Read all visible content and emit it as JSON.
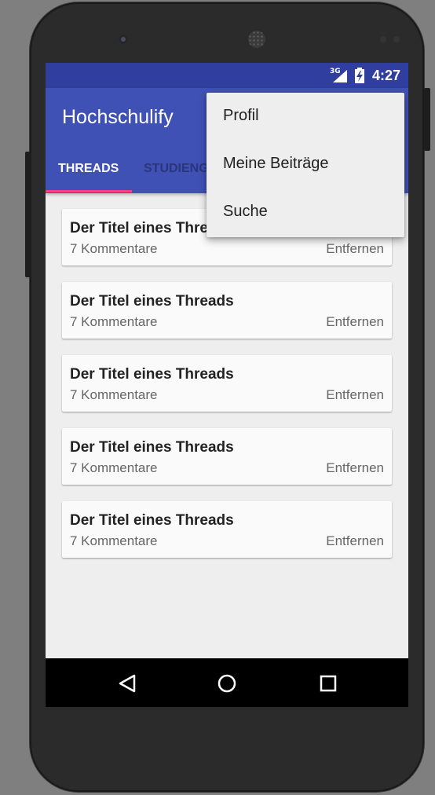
{
  "status": {
    "network": "3G",
    "time": "4:27"
  },
  "app": {
    "title": "Hochschulify"
  },
  "tabs": [
    {
      "label": "THREADS",
      "selected": true
    },
    {
      "label": "STUDIENG",
      "selected": false
    }
  ],
  "threads": [
    {
      "title": "Der Titel eines Threads",
      "comments": "7 Kommentare",
      "action": "Entfernen"
    },
    {
      "title": "Der Titel eines Threads",
      "comments": "7 Kommentare",
      "action": "Entfernen"
    },
    {
      "title": "Der Titel eines Threads",
      "comments": "7 Kommentare",
      "action": "Entfernen"
    },
    {
      "title": "Der Titel eines Threads",
      "comments": "7 Kommentare",
      "action": "Entfernen"
    },
    {
      "title": "Der Titel eines Threads",
      "comments": "7 Kommentare",
      "action": "Entfernen"
    }
  ],
  "overflow_menu": {
    "items": [
      {
        "label": "Profil"
      },
      {
        "label": "Meine Beiträge"
      },
      {
        "label": "Suche"
      }
    ]
  },
  "navbar": {
    "icons": [
      "back-icon",
      "home-icon",
      "recents-icon"
    ]
  },
  "colors": {
    "statusbar": "#303f9f",
    "appbar": "#3f51b5",
    "tab_indicator": "#ff4081",
    "background": "#eeeeee",
    "card": "#fafafa"
  }
}
